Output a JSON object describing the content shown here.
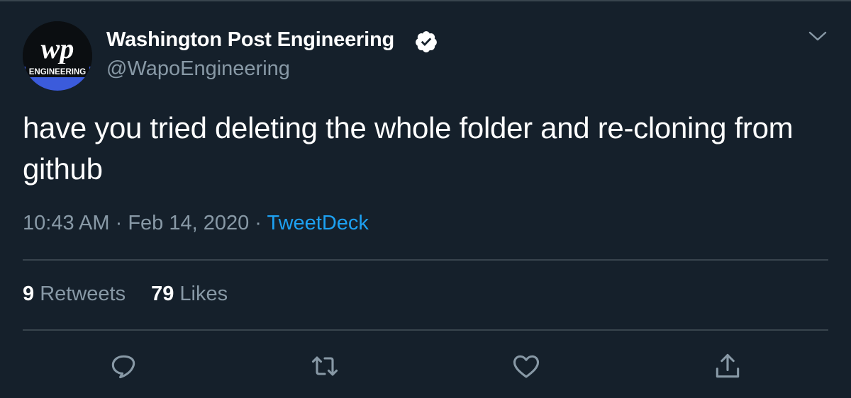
{
  "author": {
    "name": "Washington Post Engineering",
    "handle": "@WapoEngineering",
    "verified": true,
    "avatar": {
      "logo_text": "wp",
      "badge_text": "ENGINEERING"
    }
  },
  "tweet": {
    "text": "have you tried deleting the whole folder and re-cloning from github",
    "time": "10:43 AM",
    "separator": " · ",
    "date": "Feb 14, 2020",
    "source": "TweetDeck"
  },
  "stats": {
    "retweets_count": "9",
    "retweets_label": "Retweets",
    "likes_count": "79",
    "likes_label": "Likes"
  },
  "actions": {
    "icons": [
      "reply-icon",
      "retweet-icon",
      "like-icon",
      "share-icon"
    ]
  },
  "colors": {
    "background": "#15202b",
    "text": "#ffffff",
    "muted": "#8899a6",
    "accent": "#1da1f2",
    "divider": "#38444d",
    "badge_blue": "#3b5bdb"
  }
}
